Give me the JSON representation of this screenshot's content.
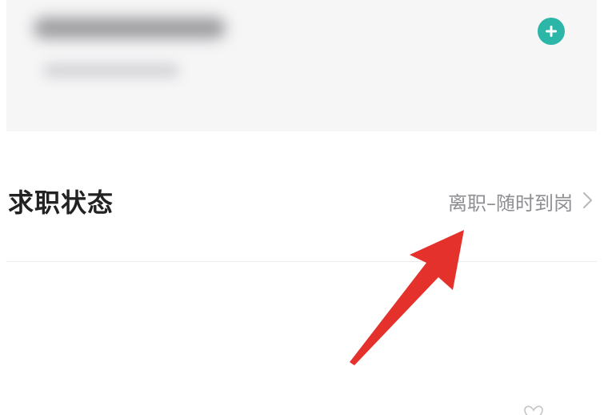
{
  "profile_card": {
    "add_icon": "plus-circle-icon",
    "accent_color": "#2bb6a7"
  },
  "job_status": {
    "title": "求职状态",
    "value": "离职–随时到岗",
    "chevron_icon": "chevron-right-icon"
  },
  "annotation": {
    "arrow_icon": "red-arrow",
    "color": "#e5312b"
  },
  "bottom": {
    "heart_icon": "heart-outline-icon"
  }
}
